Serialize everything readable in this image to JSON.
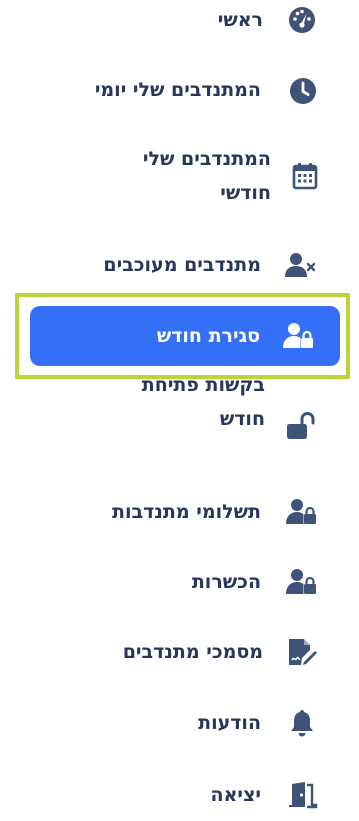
{
  "sidebar": {
    "items": [
      {
        "label": "ראשי",
        "icon": "dashboard-icon"
      },
      {
        "label": "המתנדבים שלי יומי",
        "icon": "clock-icon"
      },
      {
        "label": "המתנדבים שלי חודשי",
        "icon": "calendar-icon"
      },
      {
        "label": "מתנדבים מעוכבים",
        "icon": "user-blocked-icon"
      },
      {
        "label": "סגירת חודש",
        "icon": "user-lock-icon",
        "active": true
      },
      {
        "label": "בקשות פתיחת חודש",
        "icon": "unlock-icon"
      },
      {
        "label": "תשלומי מתנדבות",
        "icon": "user-lock-icon"
      },
      {
        "label": "הכשרות",
        "icon": "user-lock-icon"
      },
      {
        "label": "מסמכי מתנדבים",
        "icon": "file-signature-icon"
      },
      {
        "label": "הודעות",
        "icon": "bell-icon"
      },
      {
        "label": "יציאה",
        "icon": "door-icon"
      }
    ]
  },
  "colors": {
    "icon": "#3f5278",
    "text": "#27365a",
    "active_bg": "#3470f5",
    "active_text": "#ffffff",
    "highlight": "#bcd43a"
  }
}
